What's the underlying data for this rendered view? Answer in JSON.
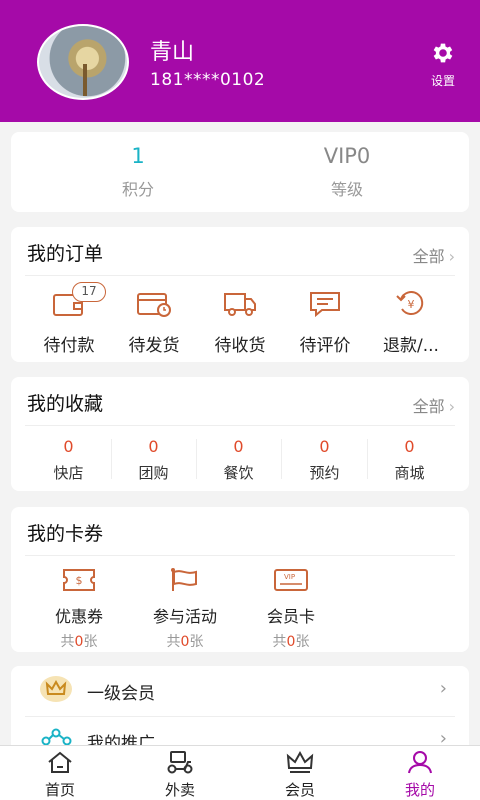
{
  "profile": {
    "name": "青山",
    "phone": "181****0102",
    "settings_label": "设置"
  },
  "stats": [
    {
      "value": "1",
      "label": "积分"
    },
    {
      "value": "VIP0",
      "label": "等级"
    }
  ],
  "orders": {
    "title": "我的订单",
    "more": "全部",
    "items": [
      {
        "label": "待付款",
        "badge": "17",
        "icon": "wallet-icon"
      },
      {
        "label": "待发货",
        "icon": "card-clock-icon"
      },
      {
        "label": "待收货",
        "icon": "truck-icon"
      },
      {
        "label": "待评价",
        "icon": "comment-icon"
      },
      {
        "label": "退款/...",
        "icon": "refund-icon"
      }
    ]
  },
  "favorites": {
    "title": "我的收藏",
    "more": "全部",
    "items": [
      {
        "count": "0",
        "label": "快店"
      },
      {
        "count": "0",
        "label": "团购"
      },
      {
        "count": "0",
        "label": "餐饮"
      },
      {
        "count": "0",
        "label": "预约"
      },
      {
        "count": "0",
        "label": "商城"
      }
    ]
  },
  "coupons": {
    "title": "我的卡券",
    "items": [
      {
        "label": "优惠券",
        "prefix": "共",
        "count": "0",
        "suffix": "张",
        "icon": "coupon-icon"
      },
      {
        "label": "参与活动",
        "prefix": "共",
        "count": "0",
        "suffix": "张",
        "icon": "flag-icon"
      },
      {
        "label": "会员卡",
        "prefix": "共",
        "count": "0",
        "suffix": "张",
        "icon": "vip-card-icon"
      }
    ]
  },
  "menu": [
    {
      "label": "一级会员",
      "icon": "crown-icon"
    },
    {
      "label": "我的推广",
      "icon": "share-icon"
    }
  ],
  "tabs": [
    {
      "label": "首页",
      "icon": "home-icon"
    },
    {
      "label": "外卖",
      "icon": "scooter-icon"
    },
    {
      "label": "会员",
      "icon": "crown-icon"
    },
    {
      "label": "我的",
      "icon": "user-icon",
      "active": true
    }
  ],
  "colors": {
    "brand": "#a50aa8",
    "accent": "#1ab3c6",
    "highlight": "#e04a2a",
    "icon_orange": "#c9663a"
  }
}
